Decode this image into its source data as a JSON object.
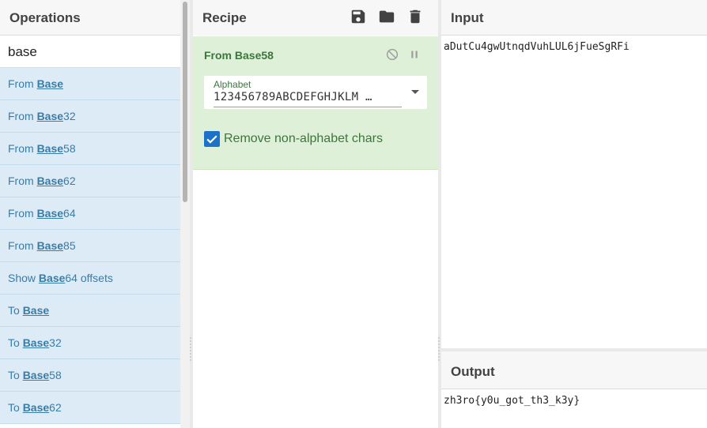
{
  "operations": {
    "title": "Operations",
    "search_value": "base",
    "items": [
      {
        "prefix": "From ",
        "match": "Base",
        "suffix": ""
      },
      {
        "prefix": "From ",
        "match": "Base",
        "suffix": "32"
      },
      {
        "prefix": "From ",
        "match": "Base",
        "suffix": "58"
      },
      {
        "prefix": "From ",
        "match": "Base",
        "suffix": "62"
      },
      {
        "prefix": "From ",
        "match": "Base",
        "suffix": "64"
      },
      {
        "prefix": "From ",
        "match": "Base",
        "suffix": "85"
      },
      {
        "prefix": "Show ",
        "match": "Base",
        "suffix": "64 offsets"
      },
      {
        "prefix": "To ",
        "match": "Base",
        "suffix": ""
      },
      {
        "prefix": "To ",
        "match": "Base",
        "suffix": "32"
      },
      {
        "prefix": "To ",
        "match": "Base",
        "suffix": "58"
      },
      {
        "prefix": "To ",
        "match": "Base",
        "suffix": "62"
      }
    ]
  },
  "recipe": {
    "title": "Recipe",
    "icons": [
      "save-icon",
      "folder-icon",
      "trash-icon"
    ],
    "operation": {
      "title": "From Base58",
      "alphabet_label": "Alphabet",
      "alphabet_value": "123456789ABCDEFGHJKLM …",
      "remove_label": "Remove non-alphabet chars",
      "remove_checked": true
    }
  },
  "input": {
    "title": "Input",
    "text": "aDutCu4gwUtnqdVuhLUL6jFueSgRFi"
  },
  "output": {
    "title": "Output",
    "text": "zh3ro{y0u_got_th3_k3y}"
  },
  "colors": {
    "op_item_bg": "#dcebf5",
    "op_item_text": "#3a7ca8",
    "recipe_op_bg": "#dff0d8",
    "recipe_op_text": "#3c763d",
    "checkbox": "#1a73c8"
  }
}
